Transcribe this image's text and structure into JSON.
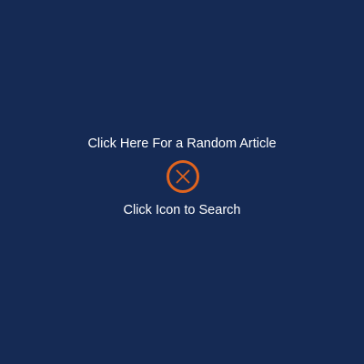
{
  "random_article": {
    "label": "Click Here For a Random Article"
  },
  "search": {
    "icon": "close-circle-icon",
    "hint": "Click Icon to Search"
  },
  "colors": {
    "background": "#152A54",
    "accent": "#E0641E",
    "text": "#FFFFFF"
  }
}
